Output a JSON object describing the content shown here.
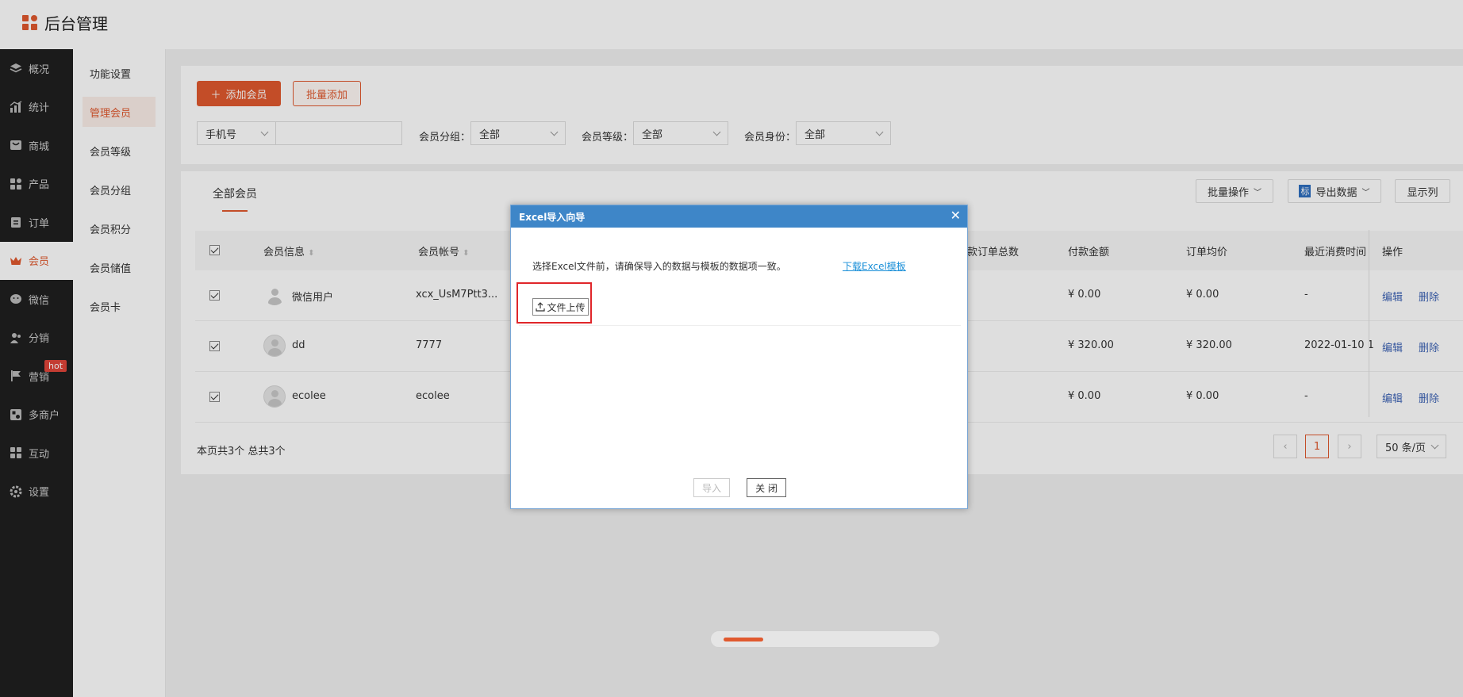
{
  "app": {
    "title": "后台管理"
  },
  "nav_primary": [
    {
      "label": "概况",
      "icon": "layers-icon"
    },
    {
      "label": "统计",
      "icon": "chart-icon"
    },
    {
      "label": "商城",
      "icon": "shop-icon"
    },
    {
      "label": "产品",
      "icon": "grid-icon"
    },
    {
      "label": "订单",
      "icon": "clipboard-icon"
    },
    {
      "label": "会员",
      "icon": "crown-icon",
      "active": true
    },
    {
      "label": "微信",
      "icon": "wechat-icon"
    },
    {
      "label": "分销",
      "icon": "users-icon"
    },
    {
      "label": "营销",
      "icon": "flag-icon",
      "badge": "hot"
    },
    {
      "label": "多商户",
      "icon": "store-icon"
    },
    {
      "label": "互动",
      "icon": "apps-icon"
    },
    {
      "label": "设置",
      "icon": "gear-icon"
    }
  ],
  "nav_secondary": [
    "功能设置",
    "管理会员",
    "会员等级",
    "会员分组",
    "会员积分",
    "会员储值",
    "会员卡"
  ],
  "toolbar": {
    "add_label": "添加会员",
    "batch_add_label": "批量添加"
  },
  "filters": {
    "phone_select": "手机号",
    "group_label": "会员分组：",
    "group_value": "全部",
    "level_label": "会员等级：",
    "level_value": "全部",
    "identity_label": "会员身份：",
    "identity_value": "全部"
  },
  "list": {
    "tab_label": "全部会员",
    "batch_ops_label": "批量操作",
    "export_icon_text": "标",
    "export_label": "导出数据",
    "columns_label": "显示列",
    "headers": {
      "info": "会员信息",
      "account": "会员帐号",
      "order_count": "款订单总数",
      "amount": "付款金额",
      "avg": "订单均价",
      "last_time": "最近消费时间",
      "ops": "操作"
    },
    "rows": [
      {
        "name": "微信用户",
        "account": "xcx_UsM7Ptt3...",
        "amount": "¥ 0.00",
        "avg": "¥ 0.00",
        "last": "-"
      },
      {
        "name": "dd",
        "account": "7777",
        "amount": "¥ 320.00",
        "avg": "¥ 320.00",
        "last": "2022-01-10 1"
      },
      {
        "name": "ecolee",
        "account": "ecolee",
        "amount": "¥ 0.00",
        "avg": "¥ 0.00",
        "last": "-"
      }
    ],
    "edit_label": "编辑",
    "delete_label": "删除",
    "summary": "本页共3个 总共3个",
    "current_page": "1",
    "page_size": "50 条/页"
  },
  "dialog": {
    "title": "Excel导入向导",
    "close": "✕",
    "instruction": "选择Excel文件前，请确保导入的数据与模板的数据项一致。",
    "download_link": "下载Excel模板",
    "upload_label": "文件上传",
    "import_label": "导入",
    "close_label": "关 闭"
  },
  "colors": {
    "accent": "#e0592e",
    "dialog_header": "#3e86c8",
    "link": "#1a8fd8",
    "highlight": "#e0262a"
  }
}
